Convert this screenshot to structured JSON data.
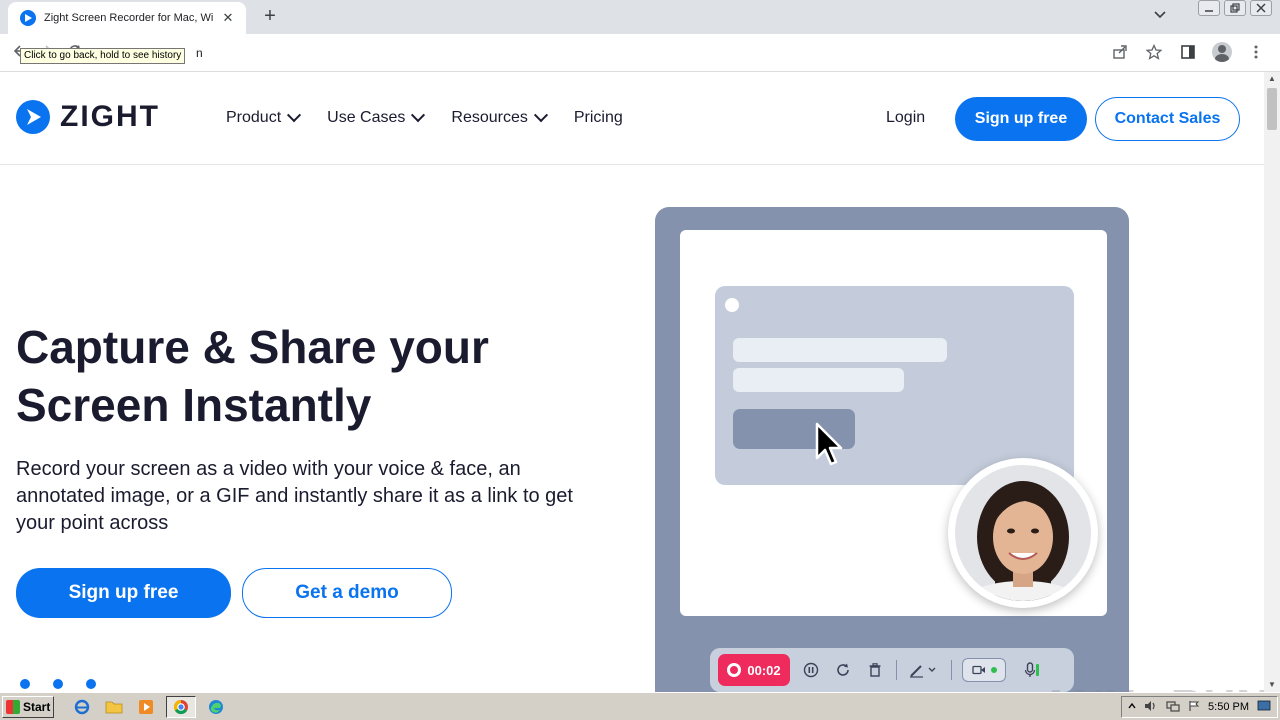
{
  "browser": {
    "tab_title": "Zight Screen Recorder for Mac, Windows",
    "tab_close": "✕",
    "new_tab": "+",
    "tooltip": "Click to go back, hold to see history",
    "url_tail": "n"
  },
  "site": {
    "logo_text": "ZIGHT",
    "nav": {
      "product": "Product",
      "use_cases": "Use Cases",
      "resources": "Resources",
      "pricing": "Pricing"
    },
    "login": "Login",
    "signup_header": "Sign up free",
    "contact_sales": "Contact Sales"
  },
  "hero": {
    "title": "Capture & Share your Screen Instantly",
    "subtitle": "Record your screen as a video with your voice & face, an annotated image, or a GIF and instantly share it as a link to get your point across",
    "signup": "Sign up free",
    "demo": "Get a demo"
  },
  "illustration": {
    "timer": "00:02"
  },
  "watermark": "ANY▷RUN",
  "taskbar": {
    "start": "Start",
    "clock": "5:50 PM"
  },
  "colors": {
    "brand_blue": "#0a73ef",
    "record_red": "#ef2a5c",
    "illustration_gray": "#8592ad"
  }
}
